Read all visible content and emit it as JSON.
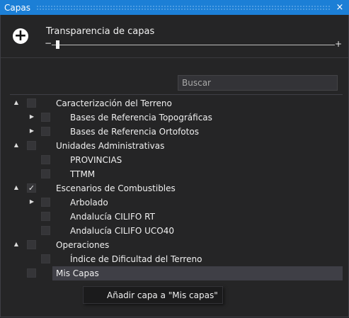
{
  "window": {
    "title": "Capas",
    "close_icon": "×"
  },
  "toolbar": {
    "add_icon": "+",
    "transparency_label": "Transparencia de capas",
    "slider_min_label": "−",
    "slider_max_label": "+",
    "slider_value_fraction": 0.01
  },
  "search": {
    "placeholder": "Buscar",
    "value": ""
  },
  "tree": [
    {
      "label": "Caracterización del Terreno",
      "level": 0,
      "arrow": "▲",
      "checked": false
    },
    {
      "label": "Bases de Referencia Topográficas",
      "level": 1,
      "arrow": "▶",
      "checked": false
    },
    {
      "label": "Bases de Referencia Ortofotos",
      "level": 1,
      "arrow": "▶",
      "checked": false
    },
    {
      "label": "Unidades Administrativas",
      "level": 0,
      "arrow": "▲",
      "checked": false
    },
    {
      "label": "PROVINCIAS",
      "level": 1,
      "arrow": "",
      "checked": false
    },
    {
      "label": "TTMM",
      "level": 1,
      "arrow": "",
      "checked": false
    },
    {
      "label": "Escenarios de Combustibles",
      "level": 0,
      "arrow": "▲",
      "checked": true
    },
    {
      "label": "Arbolado",
      "level": 1,
      "arrow": "▶",
      "checked": false
    },
    {
      "label": "Andalucía CILIFO RT",
      "level": 1,
      "arrow": "",
      "checked": false
    },
    {
      "label": "Andalucía CILIFO UCO40",
      "level": 1,
      "arrow": "",
      "checked": false
    },
    {
      "label": "Operaciones",
      "level": 0,
      "arrow": "▲",
      "checked": false
    },
    {
      "label": "Índice de Dificultad del Terreno",
      "level": 1,
      "arrow": "",
      "checked": false
    },
    {
      "label": "Mis Capas",
      "level": 0,
      "arrow": "",
      "checked": false,
      "selected": true
    }
  ],
  "context_menu": {
    "item": "Añadir capa a \"Mis capas\""
  },
  "colors": {
    "titlebar": "#1c7fd6",
    "background": "#252526",
    "selection": "#3f3f46"
  }
}
